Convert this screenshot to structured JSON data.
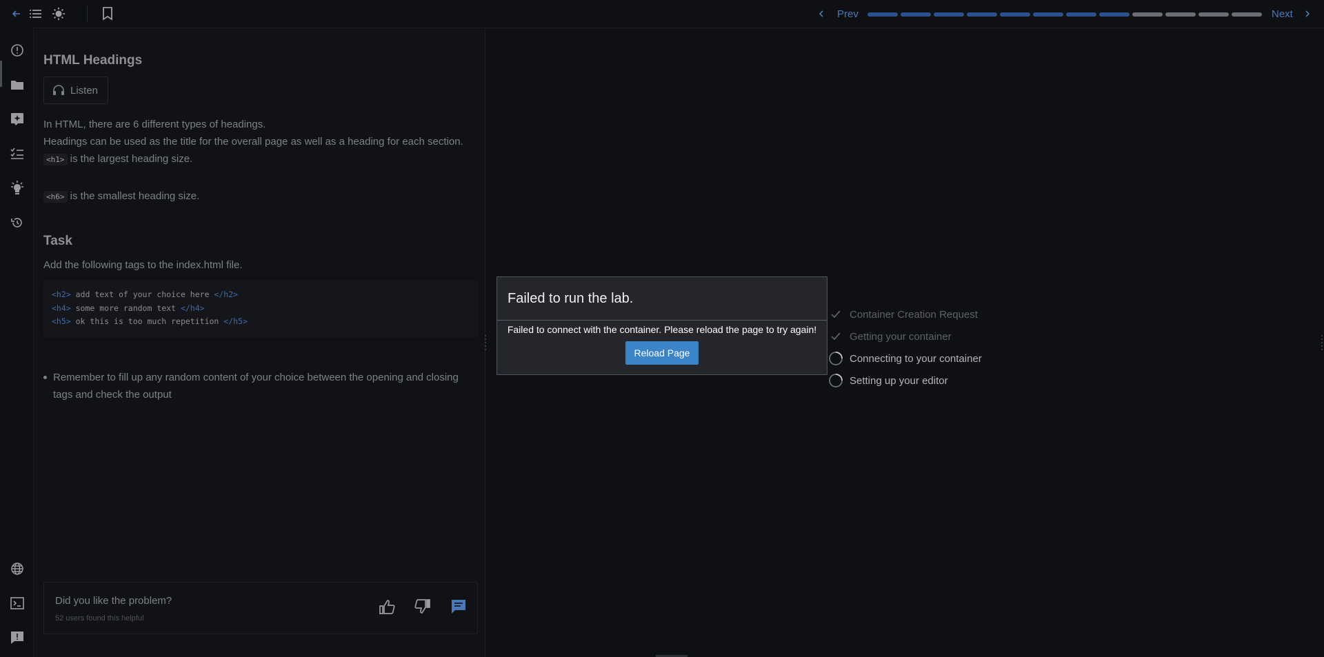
{
  "topbar": {
    "prev_label": "Prev",
    "next_label": "Next",
    "progress": {
      "total": 12,
      "completed": 8
    },
    "icons": [
      "back-arrow-icon",
      "list-icon",
      "sun-icon",
      "bookmark-icon"
    ]
  },
  "rail": {
    "top_icons": [
      "info-icon",
      "folder-icon",
      "ai-sparkle-icon",
      "checklist-icon",
      "lightbulb-icon",
      "history-icon"
    ],
    "bottom_icons": [
      "globe-icon",
      "terminal-icon",
      "report-icon"
    ]
  },
  "problem": {
    "title": "HTML Headings",
    "listen_label": "Listen",
    "intro_1": "In HTML, there are 6 different types of headings.",
    "intro_2": "Headings can be used as the title for the overall page as well as a heading for each section.",
    "h1_tag": "<h1>",
    "h1_text": " is the largest heading size.",
    "h6_tag": "<h6>",
    "h6_text": " is the smallest heading size.",
    "task_title": "Task",
    "task_desc": "Add the following tags to the index.html file.",
    "code": [
      {
        "open": "<h2>",
        "text": " add text of your choice here ",
        "close": "</h2>"
      },
      {
        "open": "<h4>",
        "text": " some more random text ",
        "close": "</h4>"
      },
      {
        "open": "<h5>",
        "text": " ok this is too much repetition ",
        "close": "</h5>"
      }
    ],
    "bullet": "Remember to fill up any random content of your choice between the opening and closing tags and check the output"
  },
  "feedback": {
    "question": "Did you like the problem?",
    "count_text": "52 users found this helpful"
  },
  "steps": [
    {
      "label": "Container Creation Request",
      "status": "done"
    },
    {
      "label": "Getting your container",
      "status": "done"
    },
    {
      "label": "Connecting to your container",
      "status": "pending"
    },
    {
      "label": "Setting up your editor",
      "status": "pending"
    }
  ],
  "modal": {
    "title": "Failed to run the lab.",
    "message": "Failed to connect with the container. Please reload the page to try again!",
    "button": "Reload Page"
  },
  "colors": {
    "accent": "#3b84c8",
    "progress_done": "#2a4f8a",
    "progress_todo": "#6b6e74",
    "link": "#4d78b8"
  }
}
